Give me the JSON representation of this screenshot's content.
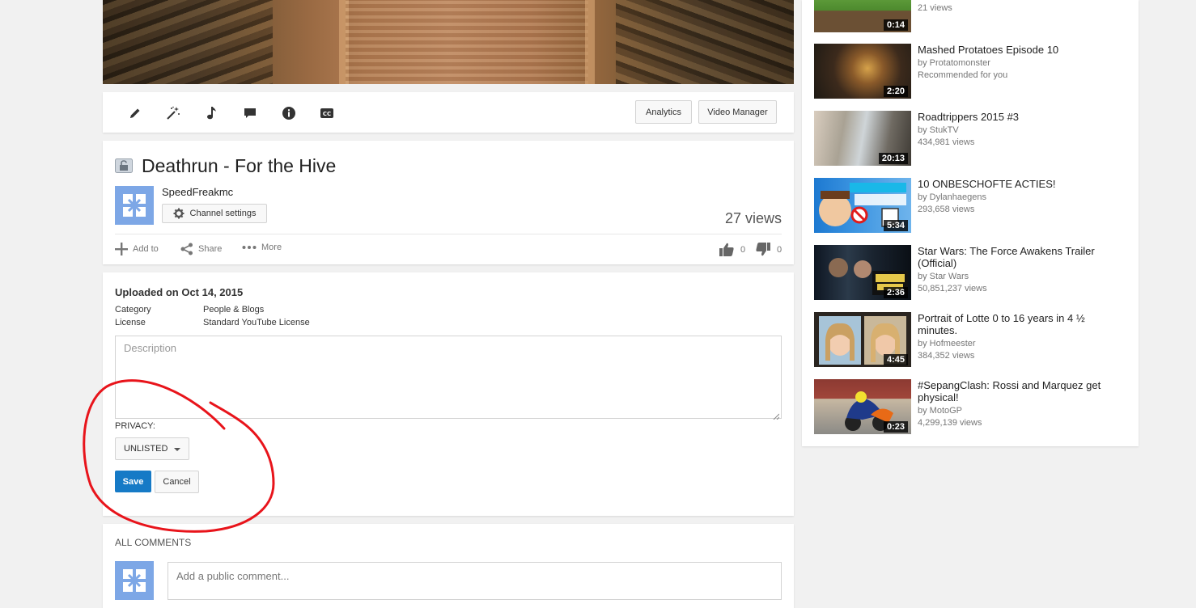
{
  "toolbar": {
    "analytics_label": "Analytics",
    "video_manager_label": "Video Manager"
  },
  "video": {
    "title": "Deathrun - For the Hive",
    "channel_name": "SpeedFreakmc",
    "channel_settings_label": "Channel settings",
    "views": "27 views",
    "add_to_label": "Add to",
    "share_label": "Share",
    "more_label": "More",
    "likes": "0",
    "dislikes": "0"
  },
  "details": {
    "uploaded": "Uploaded on Oct 14, 2015",
    "category_label": "Category",
    "category_value": "People & Blogs",
    "license_label": "License",
    "license_value": "Standard YouTube License",
    "description_placeholder": "Description",
    "privacy_label": "PRIVACY:",
    "privacy_value": "UNLISTED",
    "save_label": "Save",
    "cancel_label": "Cancel"
  },
  "comments": {
    "title": "ALL COMMENTS",
    "placeholder": "Add a public comment..."
  },
  "recommendations": [
    {
      "title": "",
      "line1": "21 views",
      "line2": "",
      "duration": "0:14"
    },
    {
      "title": "Mashed Protatoes Episode 10",
      "line1": "by Protatomonster",
      "line2": "Recommended for you",
      "duration": "2:20"
    },
    {
      "title": "Roadtrippers 2015 #3",
      "line1": "by StukTV",
      "line2": "434,981 views",
      "duration": "20:13"
    },
    {
      "title": "10 ONBESCHOFTE ACTIES!",
      "line1": "by Dylanhaegens",
      "line2": "293,658 views",
      "duration": "5:34"
    },
    {
      "title": "Star Wars: The Force Awakens Trailer (Official)",
      "line1": "by Star Wars",
      "line2": "50,851,237 views",
      "duration": "2:36"
    },
    {
      "title": "Portrait of Lotte 0 to 16 years in 4 ½ minutes.",
      "line1": "by Hofmeester",
      "line2": "384,352 views",
      "duration": "4:45"
    },
    {
      "title": "#SepangClash: Rossi and Marquez get physical!",
      "line1": "by MotoGP",
      "line2": "4,299,139 views",
      "duration": "0:23"
    }
  ],
  "colors": {
    "save_blue": "#167ac6",
    "annotation_red": "#e8141b",
    "avatar_blue": "#7da7e6"
  }
}
